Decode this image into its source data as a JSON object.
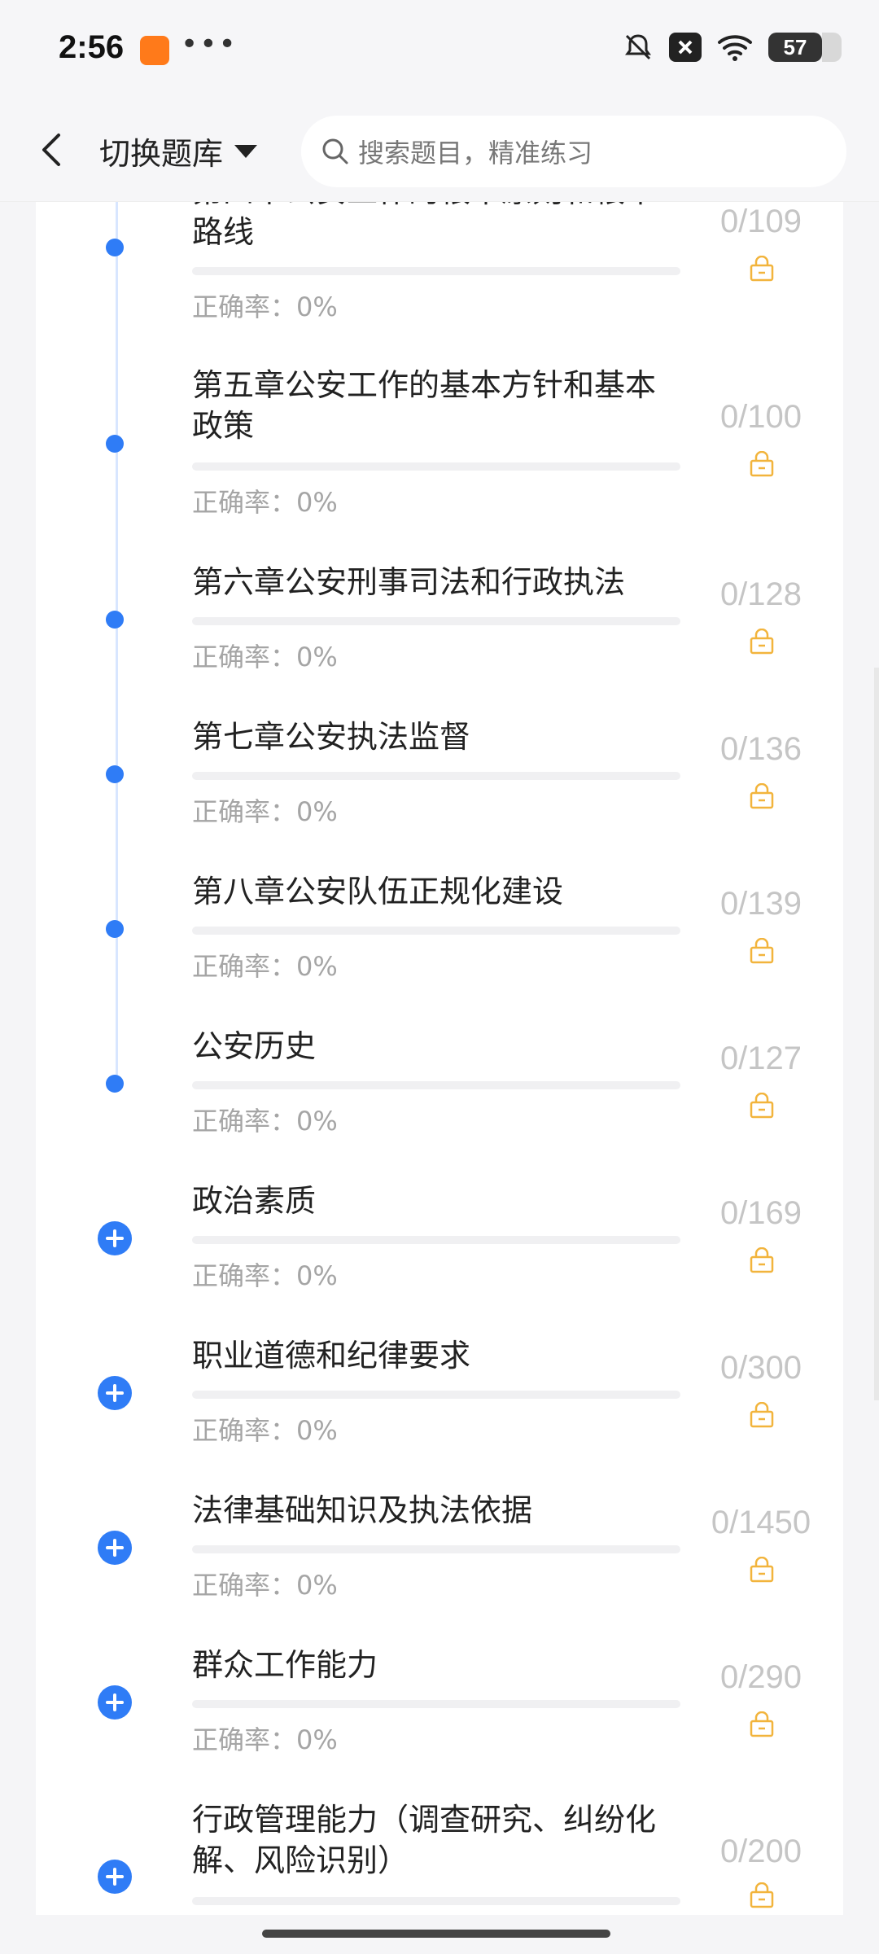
{
  "status_bar": {
    "time": "2:56",
    "battery": "57"
  },
  "header": {
    "bank_label": "切换题库",
    "search_placeholder": "搜索题目，精准练习"
  },
  "accuracy_label": "正确率：0%",
  "chapters": [
    {
      "title": "第四章公安工作的根本原则和根本路线",
      "count": "0/109",
      "kind": "dot",
      "truncated": true
    },
    {
      "title": "第五章公安工作的基本方针和基本政策",
      "count": "0/100",
      "kind": "dot"
    },
    {
      "title": "第六章公安刑事司法和行政执法",
      "count": "0/128",
      "kind": "dot"
    },
    {
      "title": "第七章公安执法监督",
      "count": "0/136",
      "kind": "dot"
    },
    {
      "title": "第八章公安队伍正规化建设",
      "count": "0/139",
      "kind": "dot"
    },
    {
      "title": "公安历史",
      "count": "0/127",
      "kind": "dot"
    },
    {
      "title": "政治素质",
      "count": "0/169",
      "kind": "plus"
    },
    {
      "title": "职业道德和纪律要求",
      "count": "0/300",
      "kind": "plus"
    },
    {
      "title": "法律基础知识及执法依据",
      "count": "0/1450",
      "kind": "plus"
    },
    {
      "title": "群众工作能力",
      "count": "0/290",
      "kind": "plus"
    },
    {
      "title": "行政管理能力（调查研究、纠纷化解、风险识别）",
      "count": "0/200",
      "kind": "plus"
    }
  ],
  "colors": {
    "accent": "#2f7cf6",
    "lock": "#f2b43c"
  }
}
